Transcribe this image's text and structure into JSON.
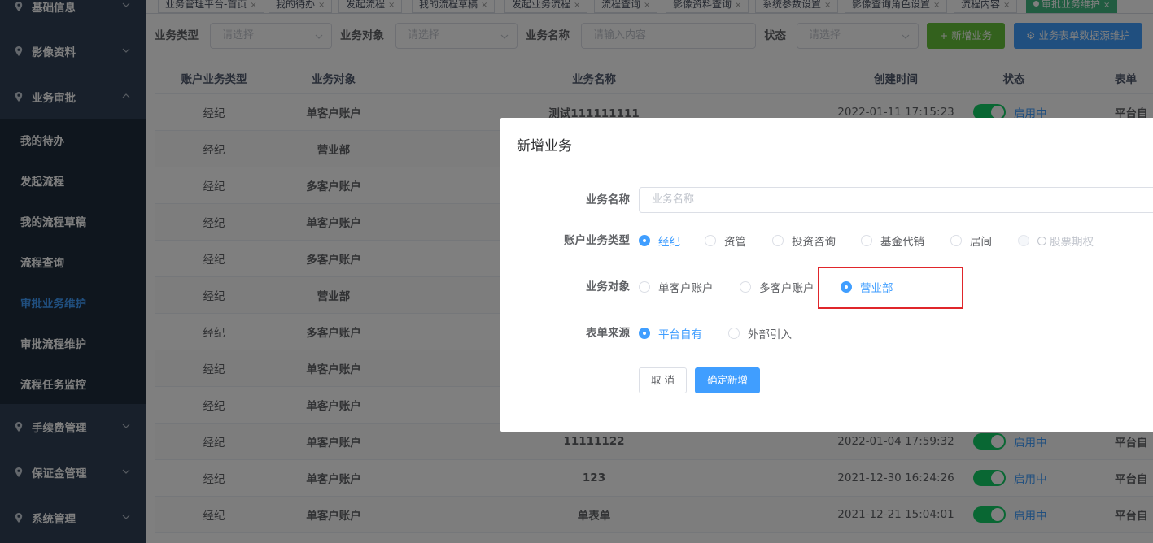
{
  "sidebar": {
    "groups_top": [
      {
        "label": "基础信息"
      },
      {
        "label": "影像资料"
      },
      {
        "label": "业务审批"
      }
    ],
    "sub_items": [
      {
        "label": "我的待办"
      },
      {
        "label": "发起流程"
      },
      {
        "label": "我的流程草稿"
      },
      {
        "label": "流程查询"
      },
      {
        "label": "审批业务维护"
      },
      {
        "label": "审批流程维护"
      },
      {
        "label": "流程任务监控"
      }
    ],
    "groups_bottom": [
      {
        "label": "手续费管理"
      },
      {
        "label": "保证金管理"
      },
      {
        "label": "系统管理"
      }
    ]
  },
  "tabs": [
    {
      "label": "业务管理平台-首页"
    },
    {
      "label": "我的待办"
    },
    {
      "label": "发起流程"
    },
    {
      "label": "我的流程草稿"
    },
    {
      "label": "发起业务流程"
    },
    {
      "label": "流程查询"
    },
    {
      "label": "影像资料查询"
    },
    {
      "label": "系统参数设置"
    },
    {
      "label": "影像查询角色设置"
    },
    {
      "label": "流程内容"
    },
    {
      "label": "审批业务维护"
    }
  ],
  "filter": {
    "type_label": "业务类型",
    "type_placeholder": "请选择",
    "object_label": "业务对象",
    "object_placeholder": "请选择",
    "name_label": "业务名称",
    "name_placeholder": "请输入内容",
    "status_label": "状态",
    "status_placeholder": "请选择",
    "add_button": "+ 新增业务",
    "datasource_button": "业务表单数据源维护"
  },
  "table": {
    "headers": [
      "账户业务类型",
      "业务对象",
      "业务名称",
      "创建时间",
      "状态",
      "表单"
    ],
    "rows": [
      {
        "type": "经纪",
        "object": "单客户账户",
        "name": "测试111111111",
        "time": "2022-01-11 17:15:23",
        "status": "启用中",
        "source": "平台自"
      },
      {
        "type": "经纪",
        "object": "营业部",
        "name": "",
        "time": "",
        "status": "",
        "source": ""
      },
      {
        "type": "经纪",
        "object": "多客户账户",
        "name": "",
        "time": "",
        "status": "",
        "source": ""
      },
      {
        "type": "经纪",
        "object": "单客户账户",
        "name": "",
        "time": "",
        "status": "",
        "source": ""
      },
      {
        "type": "经纪",
        "object": "多客户账户",
        "name": "",
        "time": "",
        "status": "",
        "source": ""
      },
      {
        "type": "经纪",
        "object": "营业部",
        "name": "",
        "time": "",
        "status": "",
        "source": ""
      },
      {
        "type": "经纪",
        "object": "多客户账户",
        "name": "",
        "time": "",
        "status": "",
        "source": ""
      },
      {
        "type": "经纪",
        "object": "单客户账户",
        "name": "",
        "time": "",
        "status": "",
        "source": ""
      },
      {
        "type": "经纪",
        "object": "单客户账户",
        "name": "",
        "time": "",
        "status": "",
        "source": ""
      },
      {
        "type": "经纪",
        "object": "单客户账户",
        "name": "11111122",
        "time": "2022-01-04 17:59:32",
        "status": "启用中",
        "source": "平台自"
      },
      {
        "type": "经纪",
        "object": "单客户账户",
        "name": "123",
        "time": "2021-12-30 16:24:26",
        "status": "启用中",
        "source": "平台自"
      },
      {
        "type": "经纪",
        "object": "单客户账户",
        "name": "单表单",
        "time": "2021-12-21 15:04:01",
        "status": "启用中",
        "source": "平台自"
      }
    ]
  },
  "dialog": {
    "title": "新增业务",
    "name_label": "业务名称",
    "name_placeholder": "业务名称",
    "type_label": "账户业务类型",
    "type_options": [
      "经纪",
      "资管",
      "投资咨询",
      "基金代销",
      "居间",
      "股票期权"
    ],
    "object_label": "业务对象",
    "object_options": [
      "单客户账户",
      "多客户账户",
      "营业部"
    ],
    "source_label": "表单来源",
    "source_options": [
      "平台自有",
      "外部引入"
    ],
    "cancel_button": "取 消",
    "ok_button": "确定新增"
  }
}
